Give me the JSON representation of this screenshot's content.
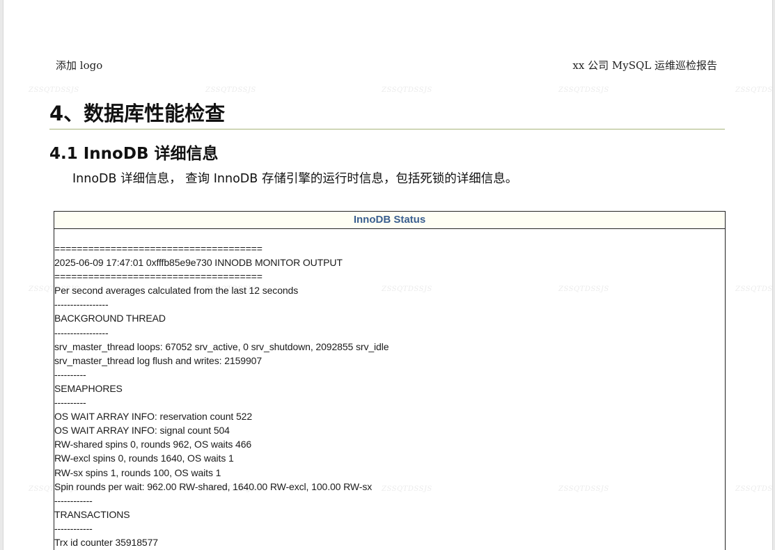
{
  "header": {
    "left": "添加 logo",
    "right": "xx 公司 MySQL 运维巡检报告"
  },
  "watermark": "ZSSQTDSSJS",
  "section": {
    "title": "4、数据库性能检查",
    "subsection_title": "4.1 InnoDB 详细信息",
    "intro": "InnoDB 详细信息， 查询 InnoDB 存储引擎的运行时信息，包括死锁的详细信息。"
  },
  "status_table": {
    "header": "InnoDB Status",
    "lines": [
      "=====================================",
      "2025-06-09 17:47:01 0xfffb85e9e730 INNODB MONITOR OUTPUT",
      "=====================================",
      "Per second averages calculated from the last 12 seconds",
      "-----------------",
      "BACKGROUND THREAD",
      "-----------------",
      "srv_master_thread loops: 67052 srv_active, 0 srv_shutdown, 2092855 srv_idle",
      "srv_master_thread log flush and writes: 2159907",
      "----------",
      "SEMAPHORES",
      "----------",
      "OS WAIT ARRAY INFO: reservation count 522",
      "OS WAIT ARRAY INFO: signal count 504",
      "RW-shared spins 0, rounds 962, OS waits 466",
      "RW-excl spins 0, rounds 1640, OS waits 1",
      "RW-sx spins 1, rounds 100, OS waits 1",
      "Spin rounds per wait: 962.00 RW-shared, 1640.00 RW-excl, 100.00 RW-sx",
      "------------",
      "TRANSACTIONS",
      "------------",
      "Trx id counter 35918577"
    ]
  }
}
